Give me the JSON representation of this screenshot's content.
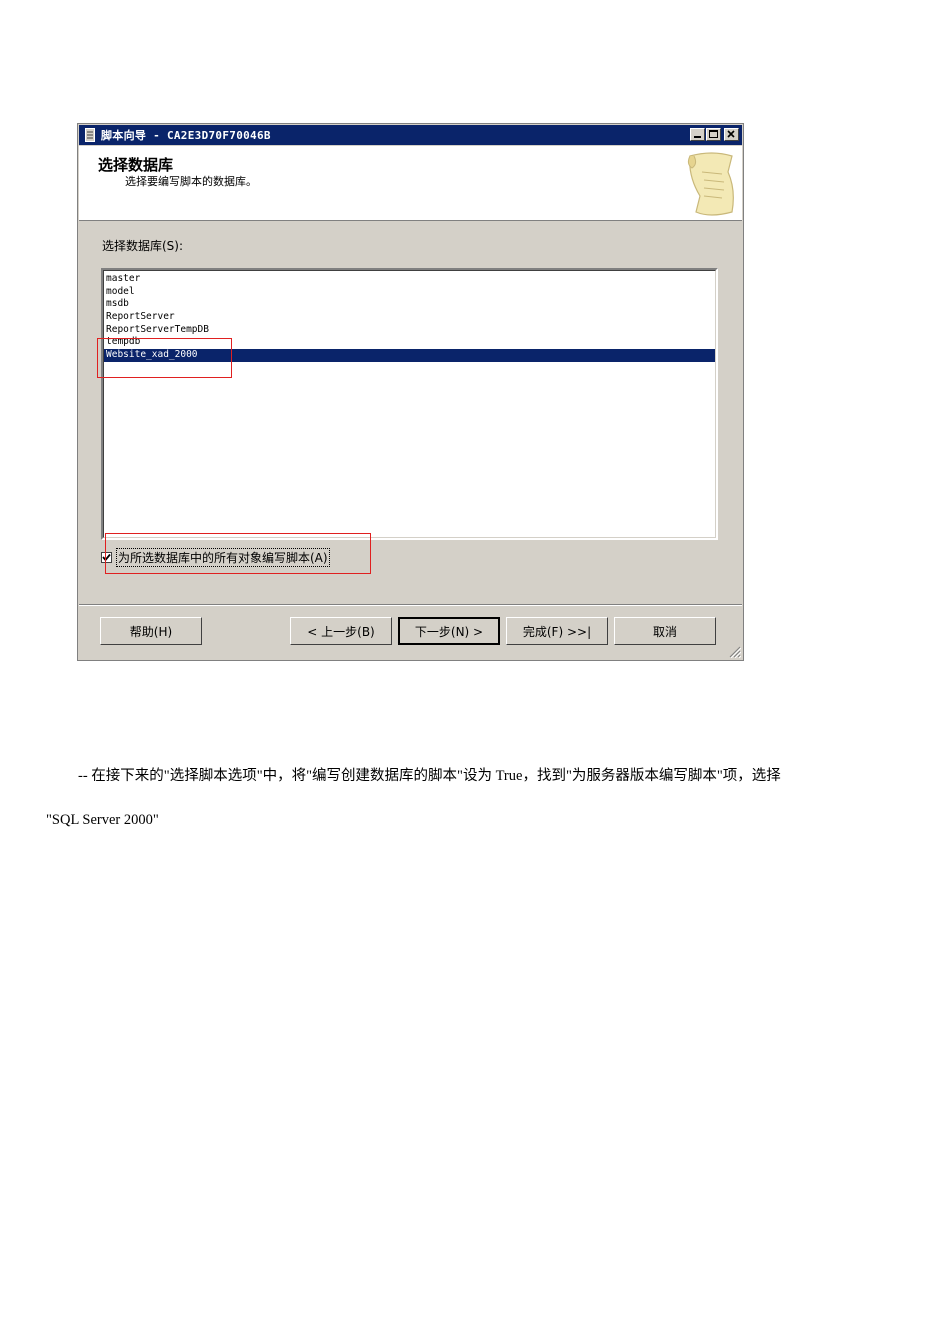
{
  "window": {
    "title": "脚本向导 - CA2E3D70F70046B"
  },
  "header": {
    "title": "选择数据库",
    "subtitle": "选择要编写脚本的数据库。"
  },
  "select_label": "选择数据库(S):",
  "databases": [
    {
      "name": "master",
      "selected": false
    },
    {
      "name": "model",
      "selected": false
    },
    {
      "name": "msdb",
      "selected": false
    },
    {
      "name": "ReportServer",
      "selected": false
    },
    {
      "name": "ReportServerTempDB",
      "selected": false
    },
    {
      "name": "tempdb",
      "selected": false
    },
    {
      "name": "Website_xad_2000",
      "selected": true
    }
  ],
  "script_all_checkbox": {
    "label": "为所选数据库中的所有对象编写脚本(A)",
    "checked": true
  },
  "buttons": {
    "help": "帮助(H)",
    "back": "< 上一步(B)",
    "next": "下一步(N) >",
    "finish": "完成(F) >>|",
    "cancel": "取消"
  },
  "colors": {
    "selection": "#0a246a",
    "highlight_box": "#e02020",
    "dialog_face": "#d4d0c8"
  },
  "caption": {
    "line1": "-- 在接下来的\"选择脚本选项\"中，将\"编写创建数据库的脚本\"设为 True，找到\"为服务器版本编写脚本\"项，选择",
    "line2": "\"SQL Server 2000\""
  }
}
